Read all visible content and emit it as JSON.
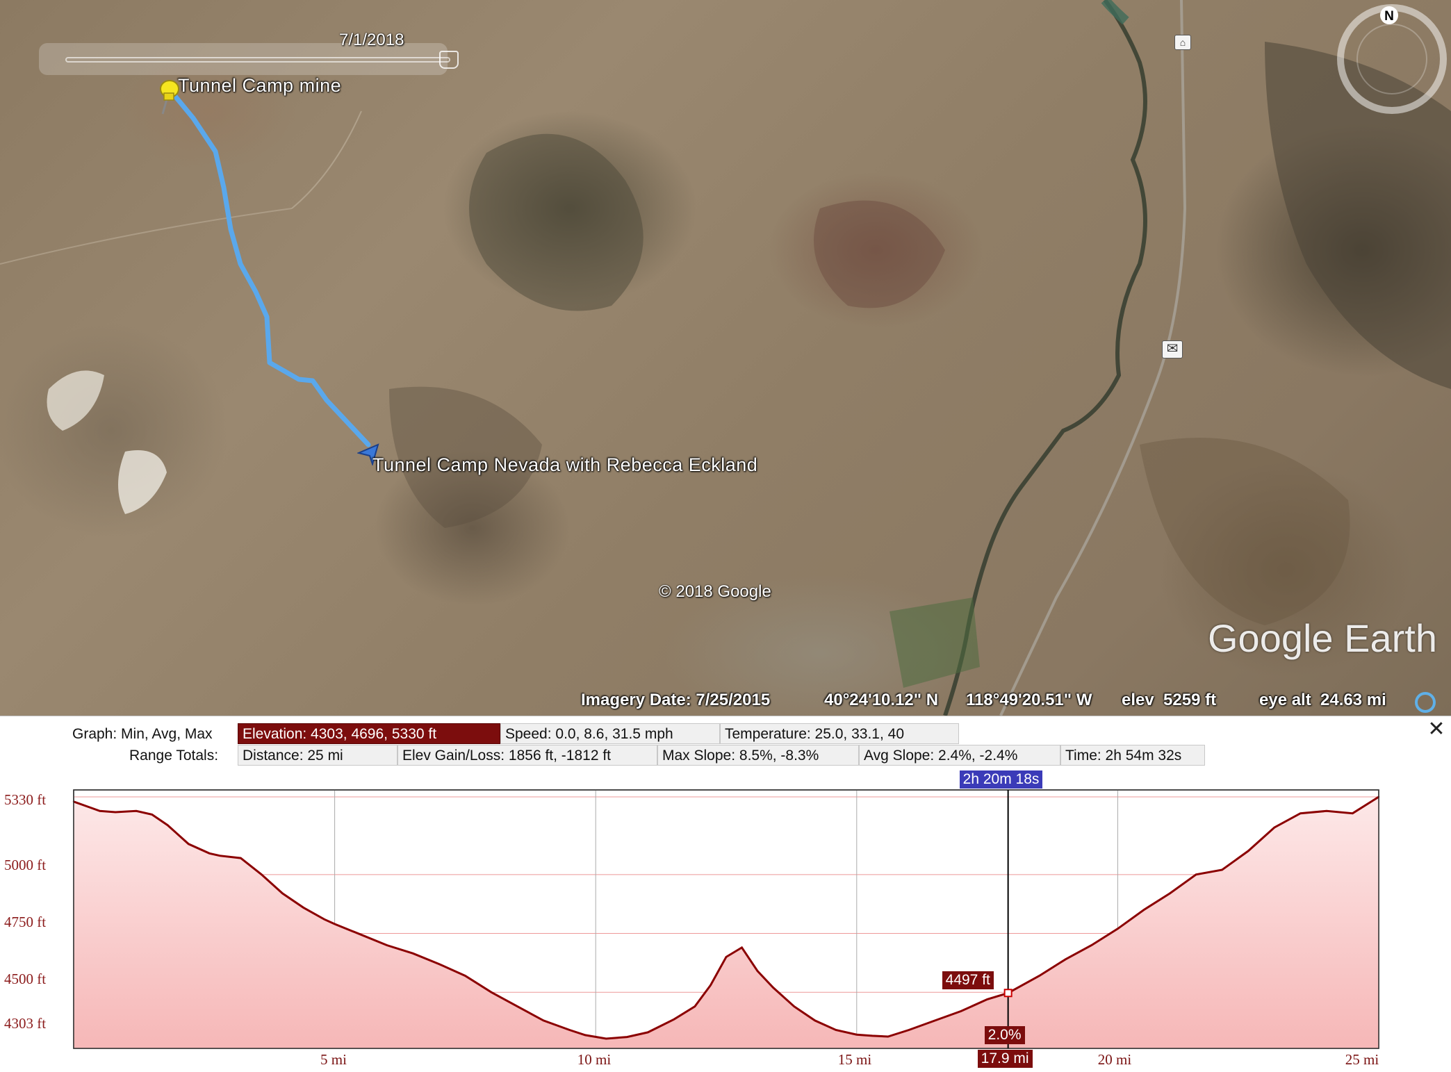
{
  "map": {
    "slider_date": "7/1/2018",
    "placemark_label": "Tunnel Camp mine",
    "track_label": "Tunnel Camp Nevada with Rebecca Eckland",
    "copyright": "© 2018 Google",
    "logo": "Google Earth",
    "compass_letter": "N",
    "track_color": "#5aa8ec",
    "icons": [
      "pushpin-icon",
      "compass-icon",
      "mail-icon",
      "lodging-icon"
    ]
  },
  "status_bar": {
    "imagery_date": "Imagery Date: 7/25/2015",
    "lat": "40°24'10.12\" N",
    "lon": "118°49'20.51\" W",
    "elev": "elev  5259 ft",
    "eye_alt": "eye alt  24.63 mi"
  },
  "elevation_profile": {
    "graph_label": "Graph: Min, Avg, Max",
    "range_label": "Range Totals:",
    "graph_stats": [
      {
        "text": "Elevation: 4303, 4696, 5330 ft",
        "active": true
      },
      {
        "text": "Speed: 0.0, 8.6, 31.5 mph",
        "active": false
      },
      {
        "text": "Temperature: 25.0, 33.1, 40",
        "active": false
      }
    ],
    "range_stats": [
      {
        "text": "Distance: 25 mi"
      },
      {
        "text": "Elev Gain/Loss: 1856 ft, -1812 ft"
      },
      {
        "text": "Max Slope: 8.5%, -8.3%"
      },
      {
        "text": "Avg Slope: 2.4%, -2.4%"
      },
      {
        "text": "Time: 2h 54m 32s"
      }
    ],
    "y_tick_labels": [
      "5330 ft",
      "5000 ft",
      "4750 ft",
      "4500 ft",
      "4303 ft"
    ],
    "x_tick_labels": [
      "5 mi",
      "10 mi",
      "15 mi",
      "20 mi",
      "25 mi"
    ],
    "cursor": {
      "time": "2h 20m 18s",
      "elevation": "4497 ft",
      "slope": "2.0%",
      "distance": "17.9 mi",
      "distance_mi": 17.9,
      "elevation_ft": 4497
    },
    "fill_color": "#f6b7b7",
    "line_color": "#8b0000"
  },
  "chart_data": {
    "type": "area",
    "xlabel": "",
    "ylabel": "",
    "xlim": [
      0,
      25
    ],
    "ylim": [
      4303,
      5330
    ],
    "x": [
      0,
      0.5,
      0.8,
      1.2,
      1.5,
      1.8,
      2.2,
      2.6,
      2.8,
      3.2,
      3.6,
      4.0,
      4.4,
      4.8,
      5.0,
      5.5,
      6.0,
      6.5,
      7.0,
      7.5,
      8.0,
      8.5,
      9.0,
      9.5,
      9.8,
      10.2,
      10.6,
      11.0,
      11.5,
      11.9,
      12.2,
      12.5,
      12.8,
      13.1,
      13.4,
      13.8,
      14.2,
      14.6,
      15.0,
      15.3,
      15.6,
      16.0,
      16.5,
      17.0,
      17.5,
      17.9,
      18.5,
      19.0,
      19.5,
      20.0,
      20.5,
      21.0,
      21.5,
      22.0,
      22.5,
      23.0,
      23.5,
      24.0,
      24.5,
      25.0
    ],
    "y": [
      5310,
      5270,
      5265,
      5270,
      5255,
      5210,
      5130,
      5090,
      5080,
      5070,
      5000,
      4920,
      4860,
      4810,
      4790,
      4745,
      4700,
      4665,
      4620,
      4570,
      4500,
      4440,
      4380,
      4340,
      4318,
      4303,
      4310,
      4330,
      4385,
      4440,
      4530,
      4650,
      4690,
      4590,
      4520,
      4440,
      4380,
      4340,
      4320,
      4315,
      4312,
      4340,
      4380,
      4420,
      4470,
      4497,
      4570,
      4640,
      4700,
      4770,
      4850,
      4920,
      5000,
      5020,
      5100,
      5200,
      5260,
      5270,
      5260,
      5330
    ]
  }
}
